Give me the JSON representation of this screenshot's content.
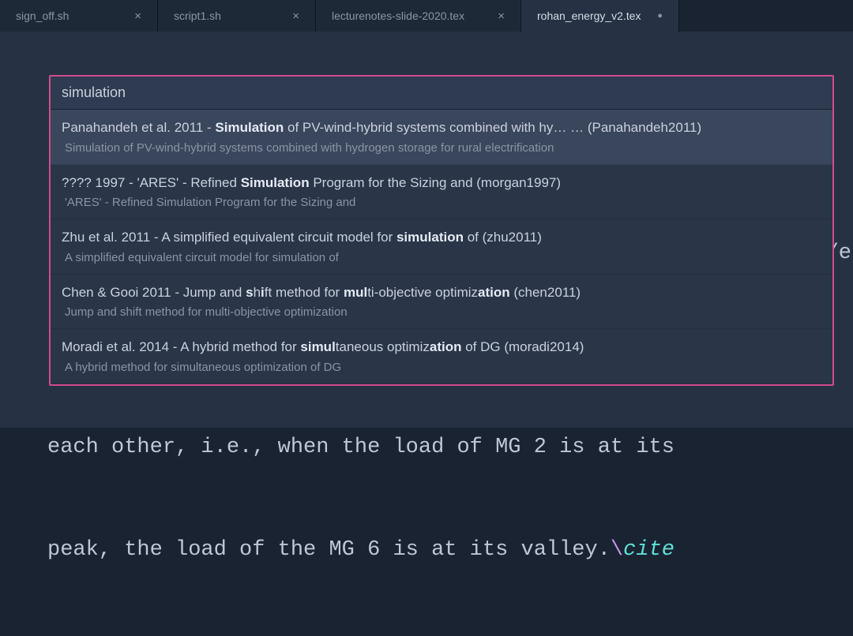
{
  "tabs": [
    {
      "label": "sign_off.sh",
      "active": false,
      "dirty": false
    },
    {
      "label": "script1.sh",
      "active": false,
      "dirty": false
    },
    {
      "label": "lecturenotes-slide-2020.tex",
      "active": false,
      "dirty": false
    },
    {
      "label": "rohan_energy_v2.tex",
      "active": true,
      "dirty": true
    }
  ],
  "search": {
    "query": "simulation"
  },
  "results": [
    {
      "title_pre": "Panahandeh et al. 2011 - ",
      "title_hl1": "Simulation",
      "title_mid": " of PV-wind-hybrid systems combined with hy… … (Panahandeh2011)",
      "subtitle": "Simulation of PV-wind-hybrid systems combined with hydrogen storage for rural electrification",
      "selected": true
    },
    {
      "title_pre": "???? 1997 - 'ARES' - Refined ",
      "title_hl1": "Simulation",
      "title_mid": " Program for the Sizing and (morgan1997)",
      "subtitle": "'ARES' - Refined Simulation Program for the Sizing and",
      "selected": false
    },
    {
      "title_segments": [
        {
          "t": "Zhu et al. 2011 - A simplified equivalent circuit model for ",
          "hl": false
        },
        {
          "t": "simulation",
          "hl": true
        },
        {
          "t": " of (zhu2011)",
          "hl": false
        }
      ],
      "subtitle": "A simplified equivalent circuit model for simulation of",
      "selected": false
    },
    {
      "title_segments": [
        {
          "t": "Chen & Gooi 2011 - Jump and ",
          "hl": false
        },
        {
          "t": "s",
          "hl": true
        },
        {
          "t": "h",
          "hl": false
        },
        {
          "t": "i",
          "hl": true
        },
        {
          "t": "ft method for ",
          "hl": false
        },
        {
          "t": "mul",
          "hl": true
        },
        {
          "t": "ti-objective optimiz",
          "hl": false
        },
        {
          "t": "ation",
          "hl": true
        },
        {
          "t": " (chen2011)",
          "hl": false
        }
      ],
      "subtitle": "Jump and shift method for multi-objective optimization",
      "selected": false
    },
    {
      "title_segments": [
        {
          "t": "Moradi et al. 2014 - A hybrid method for ",
          "hl": false
        },
        {
          "t": "simul",
          "hl": true
        },
        {
          "t": "taneous optimiz",
          "hl": false
        },
        {
          "t": "ation",
          "hl": true
        },
        {
          "t": " of DG (moradi2014)",
          "hl": false
        }
      ],
      "subtitle": "A hybrid method for simultaneous optimization of DG",
      "selected": false
    }
  ],
  "code": {
    "partial_right": "/e",
    "line1": "each other, i.e., when the load of MG 2 is at its",
    "line2a": "peak, the load of the MG 6 is at its valley.",
    "line2_backslash": "\\",
    "line2_cite": "cite"
  }
}
